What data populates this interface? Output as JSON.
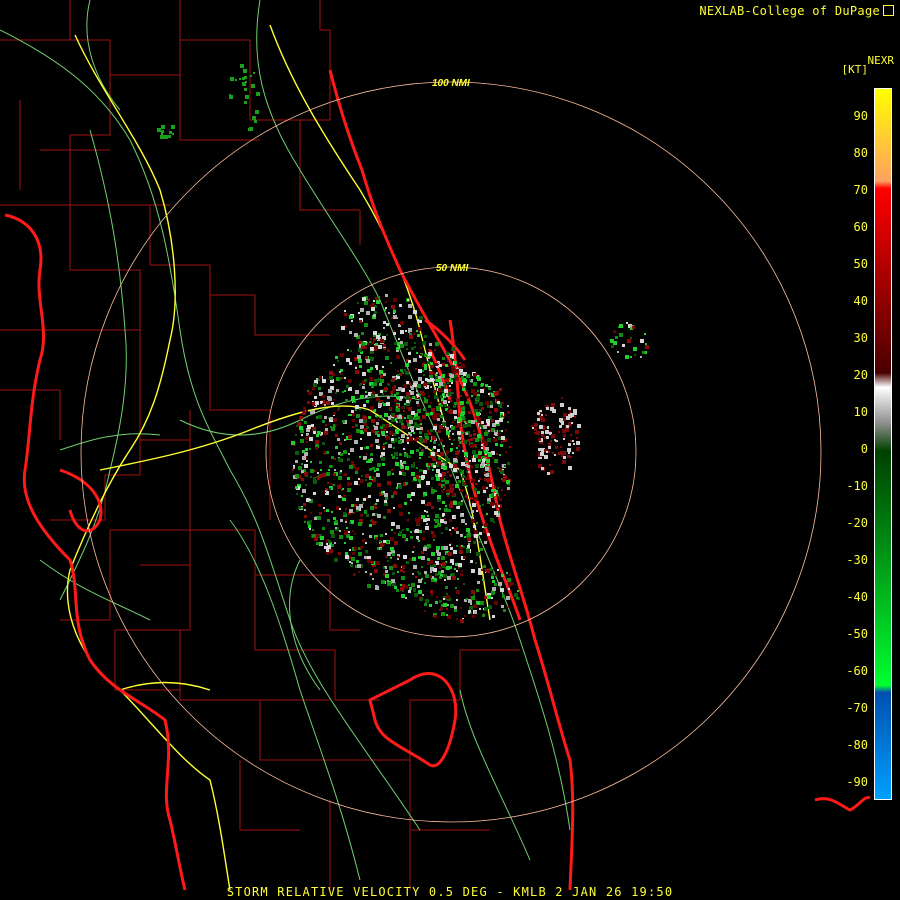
{
  "header": {
    "brand": "NEXLAB-College of DuPage"
  },
  "legend": {
    "product_code": "NEXR",
    "unit": "[KT]",
    "ticks": [
      "90",
      "80",
      "70",
      "60",
      "50",
      "40",
      "30",
      "20",
      "10",
      "0",
      "-10",
      "-20",
      "-30",
      "-40",
      "-50",
      "-60",
      "-70",
      "-80",
      "-90"
    ],
    "colors": {
      "high": "#ffff00",
      "orange": "#ffa060",
      "red": "#ff0000",
      "dark_red": "#4a0000",
      "gray": "#909090",
      "dark_green": "#004000",
      "green": "#00ff30",
      "blue": "#0050b0",
      "light_blue": "#00a0ff"
    }
  },
  "range_rings": [
    {
      "label": "100 NMI"
    },
    {
      "label": "50 NMI"
    }
  ],
  "footer": {
    "caption": "STORM RELATIVE VELOCITY 0.5 DEG - KMLB 2 JAN 26 19:50"
  },
  "map_colors": {
    "coastline": "#ff1a1a",
    "county_lines": "#b01010",
    "roads": "#80e080",
    "interstates": "#ffff33",
    "rings": "#ffc0a0"
  }
}
